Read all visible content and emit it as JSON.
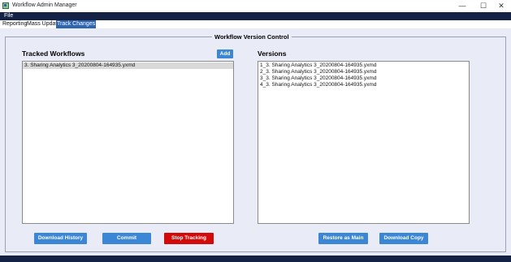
{
  "window": {
    "title": "Workflow Admin Manager",
    "min_glyph": "—",
    "max_glyph": "☐",
    "close_glyph": "✕"
  },
  "menu": {
    "file": "File"
  },
  "tabs": [
    {
      "label": "Reporting",
      "active": false
    },
    {
      "label": "Mass Update",
      "active": false
    },
    {
      "label": "Track Changes",
      "active": true
    }
  ],
  "group": {
    "legend": "Workflow Version Control"
  },
  "tracked": {
    "title": "Tracked Workflows",
    "add_label": "Add",
    "items": [
      "3. Sharing Analytics 3_20200804-164935.yxmd"
    ]
  },
  "versions": {
    "title": "Versions",
    "items": [
      "1_3. Sharing Analytics 3_20200804-164935.yxmd",
      "2_3. Sharing Analytics 3_20200804-164935.yxmd",
      "3_3. Sharing Analytics 3_20200804-164935.yxmd",
      "4_3. Sharing Analytics 3_20200804-164935.yxmd"
    ]
  },
  "buttons": {
    "download_history": "Download History",
    "commit": "Commit",
    "stop_tracking": "Stop Tracking",
    "restore_as_main": "Restore as Main",
    "download_copy": "Download Copy"
  },
  "colors": {
    "accent_blue": "#3c86d6",
    "danger_red": "#d20a0a",
    "navy_bar": "#142245",
    "panel_bg": "#e9ecf6",
    "active_tab": "#2f64b0"
  }
}
